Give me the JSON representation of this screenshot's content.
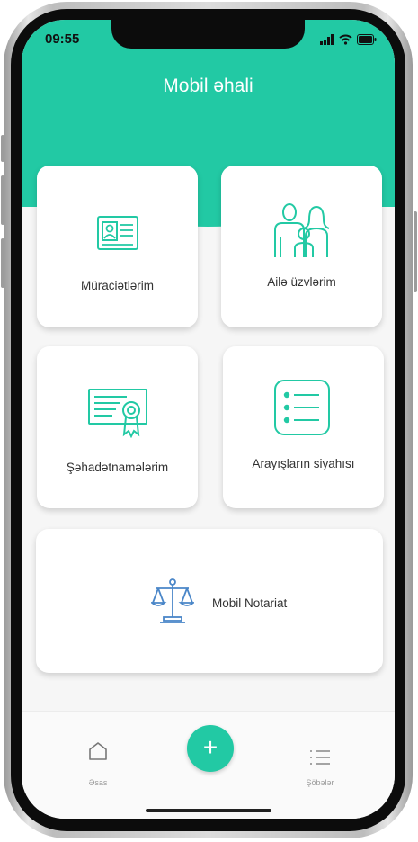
{
  "status_bar": {
    "time": "09:55"
  },
  "header": {
    "title": "Mobil əhali"
  },
  "cards": {
    "applications": "Müraciətlərim",
    "family": "Ailə üzvlərim",
    "certificates": "Şəhadətnamələrim",
    "references": "Arayışların siyahısı",
    "notary": "Mobil Notariat"
  },
  "bottom_nav": {
    "home": "Əsas",
    "fab": "+",
    "branches": "Şöbələr"
  },
  "colors": {
    "accent": "#22c9a4",
    "icon_blue": "#4a86c8"
  }
}
